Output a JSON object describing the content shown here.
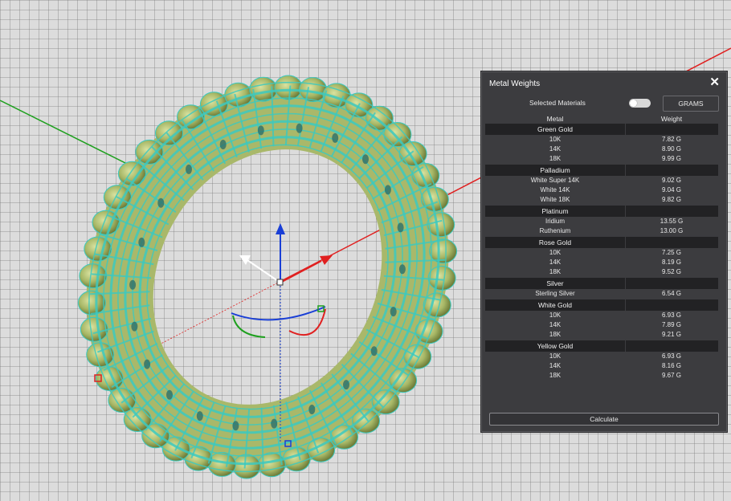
{
  "panel": {
    "title": "Metal Weights",
    "close_icon": "close-icon",
    "selected_materials_label": "Selected Materials",
    "toggle_state": "off",
    "units_button": "GRAMS",
    "column_metal": "Metal",
    "column_weight": "Weight",
    "calculate_button": "Calculate"
  },
  "groups": [
    {
      "name": "Green Gold",
      "rows": [
        {
          "alloy": "10K",
          "weight": "7.82 G"
        },
        {
          "alloy": "14K",
          "weight": "8.90 G"
        },
        {
          "alloy": "18K",
          "weight": "9.99 G"
        }
      ]
    },
    {
      "name": "Palladium",
      "rows": [
        {
          "alloy": "White Super 14K",
          "weight": "9.02 G"
        },
        {
          "alloy": "White 14K",
          "weight": "9.04 G"
        },
        {
          "alloy": "White 18K",
          "weight": "9.82 G"
        }
      ]
    },
    {
      "name": "Platinum",
      "rows": [
        {
          "alloy": "Iridium",
          "weight": "13.55 G"
        },
        {
          "alloy": "Ruthenium",
          "weight": "13.00 G"
        }
      ]
    },
    {
      "name": "Rose Gold",
      "rows": [
        {
          "alloy": "10K",
          "weight": "7.25 G"
        },
        {
          "alloy": "14K",
          "weight": "8.19 G"
        },
        {
          "alloy": "18K",
          "weight": "9.52 G"
        }
      ]
    },
    {
      "name": "Silver",
      "rows": [
        {
          "alloy": "Sterling Silver",
          "weight": "6.54 G"
        }
      ]
    },
    {
      "name": "White Gold",
      "rows": [
        {
          "alloy": "10K",
          "weight": "6.93 G"
        },
        {
          "alloy": "14K",
          "weight": "7.89 G"
        },
        {
          "alloy": "18K",
          "weight": "9.21 G"
        }
      ]
    },
    {
      "name": "Yellow Gold",
      "rows": [
        {
          "alloy": "10K",
          "weight": "6.93 G"
        },
        {
          "alloy": "14K",
          "weight": "8.16 G"
        },
        {
          "alloy": "18K",
          "weight": "9.67 G"
        }
      ]
    }
  ],
  "colors": {
    "panel_bg": "#3c3c3f",
    "group_header_bg": "#222224",
    "ring_wire": "#3cc9c0",
    "ring_metal": "#a9b86a",
    "axis_x": "#e02020",
    "axis_y": "#1fa01f",
    "axis_z": "#1a3fd6"
  }
}
